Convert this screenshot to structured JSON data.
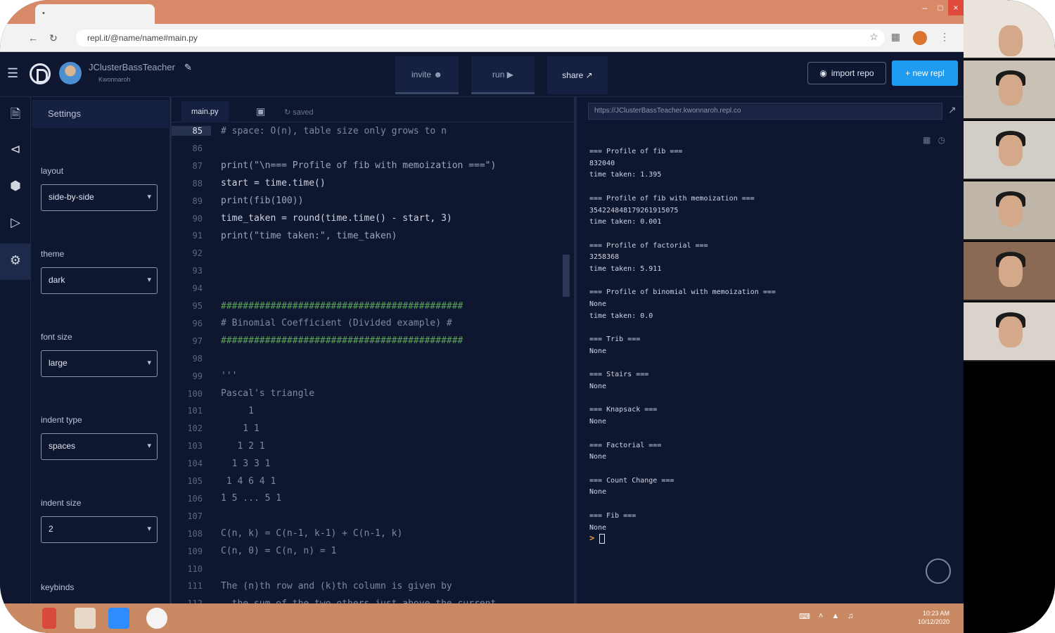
{
  "browser": {
    "tab_title": "•",
    "address": "repl.it/@name/name#main.py",
    "nav_icons": [
      "back-icon",
      "forward-icon",
      "reload-icon"
    ]
  },
  "header": {
    "repl_name": "JClusterBassTeacher",
    "repl_owner": "Kwonnaroh",
    "invite_label": "invite",
    "run_label": "run",
    "share_label": "share",
    "import_label": "import repo",
    "new_label": "+ new repl"
  },
  "settings": {
    "title": "Settings",
    "layout_label": "layout",
    "layout_value": "side-by-side",
    "theme_label": "theme",
    "theme_value": "dark",
    "font_size_label": "font size",
    "font_size_value": "large",
    "indent_type_label": "indent type",
    "indent_type_value": "spaces",
    "indent_size_label": "indent size",
    "indent_size_value": "2",
    "keybinds_label": "keybinds"
  },
  "editor": {
    "tab_main": "main.py",
    "tab_console": "↻ saved",
    "lines": [
      {
        "n": "85",
        "text": "# space: O(n), table size only grows to n",
        "kind": "comment",
        "current": true
      },
      {
        "n": "86",
        "text": "",
        "kind": "code"
      },
      {
        "n": "87",
        "text": "print(\"\\n=== Profile of fib with memoization ===\")",
        "kind": "str"
      },
      {
        "n": "88",
        "text": "start = time.time()",
        "kind": "code"
      },
      {
        "n": "89",
        "text": "print(fib(100))",
        "kind": "str"
      },
      {
        "n": "90",
        "text": "time_taken = round(time.time() - start, 3)",
        "kind": "code"
      },
      {
        "n": "91",
        "text": "print(\"time taken:\", time_taken)",
        "kind": "str"
      },
      {
        "n": "92",
        "text": "",
        "kind": "code"
      },
      {
        "n": "93",
        "text": "",
        "kind": "code"
      },
      {
        "n": "94",
        "text": "",
        "kind": "code"
      },
      {
        "n": "95",
        "text": "############################################",
        "kind": "hash"
      },
      {
        "n": "96",
        "text": "# Binomial Coefficient (Divided example) #",
        "kind": "comment"
      },
      {
        "n": "97",
        "text": "############################################",
        "kind": "hash"
      },
      {
        "n": "98",
        "text": "",
        "kind": "code"
      },
      {
        "n": "99",
        "text": "'''",
        "kind": "comment"
      },
      {
        "n": "100",
        "text": "Pascal's triangle",
        "kind": "comment"
      },
      {
        "n": "101",
        "text": "     1",
        "kind": "comment"
      },
      {
        "n": "102",
        "text": "    1 1",
        "kind": "comment"
      },
      {
        "n": "103",
        "text": "   1 2 1",
        "kind": "comment"
      },
      {
        "n": "104",
        "text": "  1 3 3 1",
        "kind": "comment"
      },
      {
        "n": "105",
        "text": " 1 4 6 4 1",
        "kind": "comment"
      },
      {
        "n": "106",
        "text": "1 5 ... 5 1",
        "kind": "comment"
      },
      {
        "n": "107",
        "text": "",
        "kind": "comment"
      },
      {
        "n": "108",
        "text": "C(n, k) = C(n-1, k-1) + C(n-1, k)",
        "kind": "comment"
      },
      {
        "n": "109",
        "text": "C(n, 0) = C(n, n) = 1",
        "kind": "comment"
      },
      {
        "n": "110",
        "text": "",
        "kind": "comment"
      },
      {
        "n": "111",
        "text": "The (n)th row and (k)th column is given by",
        "kind": "comment"
      },
      {
        "n": "112",
        "text": "  the sum of the two others just above the current",
        "kind": "comment"
      }
    ]
  },
  "console": {
    "url": "https://JClusterBassTeacher.kwonnaroh.repl.co",
    "output": "=== Profile of fib ===\n832040\ntime taken: 1.395\n\n=== Profile of fib with memoization ===\n354224848179261915075\ntime taken: 0.001\n\n=== Profile of factorial ===\n3258368\ntime taken: 5.911\n\n=== Profile of binomial with memoization ===\nNone\ntime taken: 0.0\n\n=== Trib ===\nNone\n\n=== Stairs ===\nNone\n\n=== Knapsack ===\nNone\n\n=== Factorial ===\nNone\n\n=== Count Change ===\nNone\n\n=== Fib ===\nNone",
    "prompt": ">"
  },
  "taskbar": {
    "time": "10:23 AM",
    "date": "10/12/2020"
  },
  "colors": {
    "accent": "#1f9cf0",
    "background": "#0f1730",
    "taskbar": "#c98a63"
  }
}
